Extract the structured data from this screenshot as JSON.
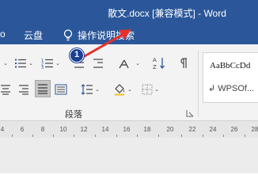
{
  "window": {
    "title": "散文.docx [兼容模式]  -  Word"
  },
  "menu": {
    "item_partial": "о",
    "cloud": "云盘",
    "help": "操作说明搜索"
  },
  "ribbon": {
    "group_label": "段落",
    "styles": [
      "AaBbCcDd",
      "↲ WPSOf..."
    ]
  },
  "annotation": {
    "badge_number": "1",
    "arrow_color": "#e8302a"
  },
  "ruler": {
    "labels": [
      "4",
      "6",
      "8",
      "10",
      "12",
      "14",
      "16",
      "18",
      "20",
      "22",
      "24",
      "26",
      "28"
    ]
  },
  "colors": {
    "title_bar": "#2b579a",
    "ribbon": "#f3f3f3",
    "ruler": "#e6e6e6"
  }
}
